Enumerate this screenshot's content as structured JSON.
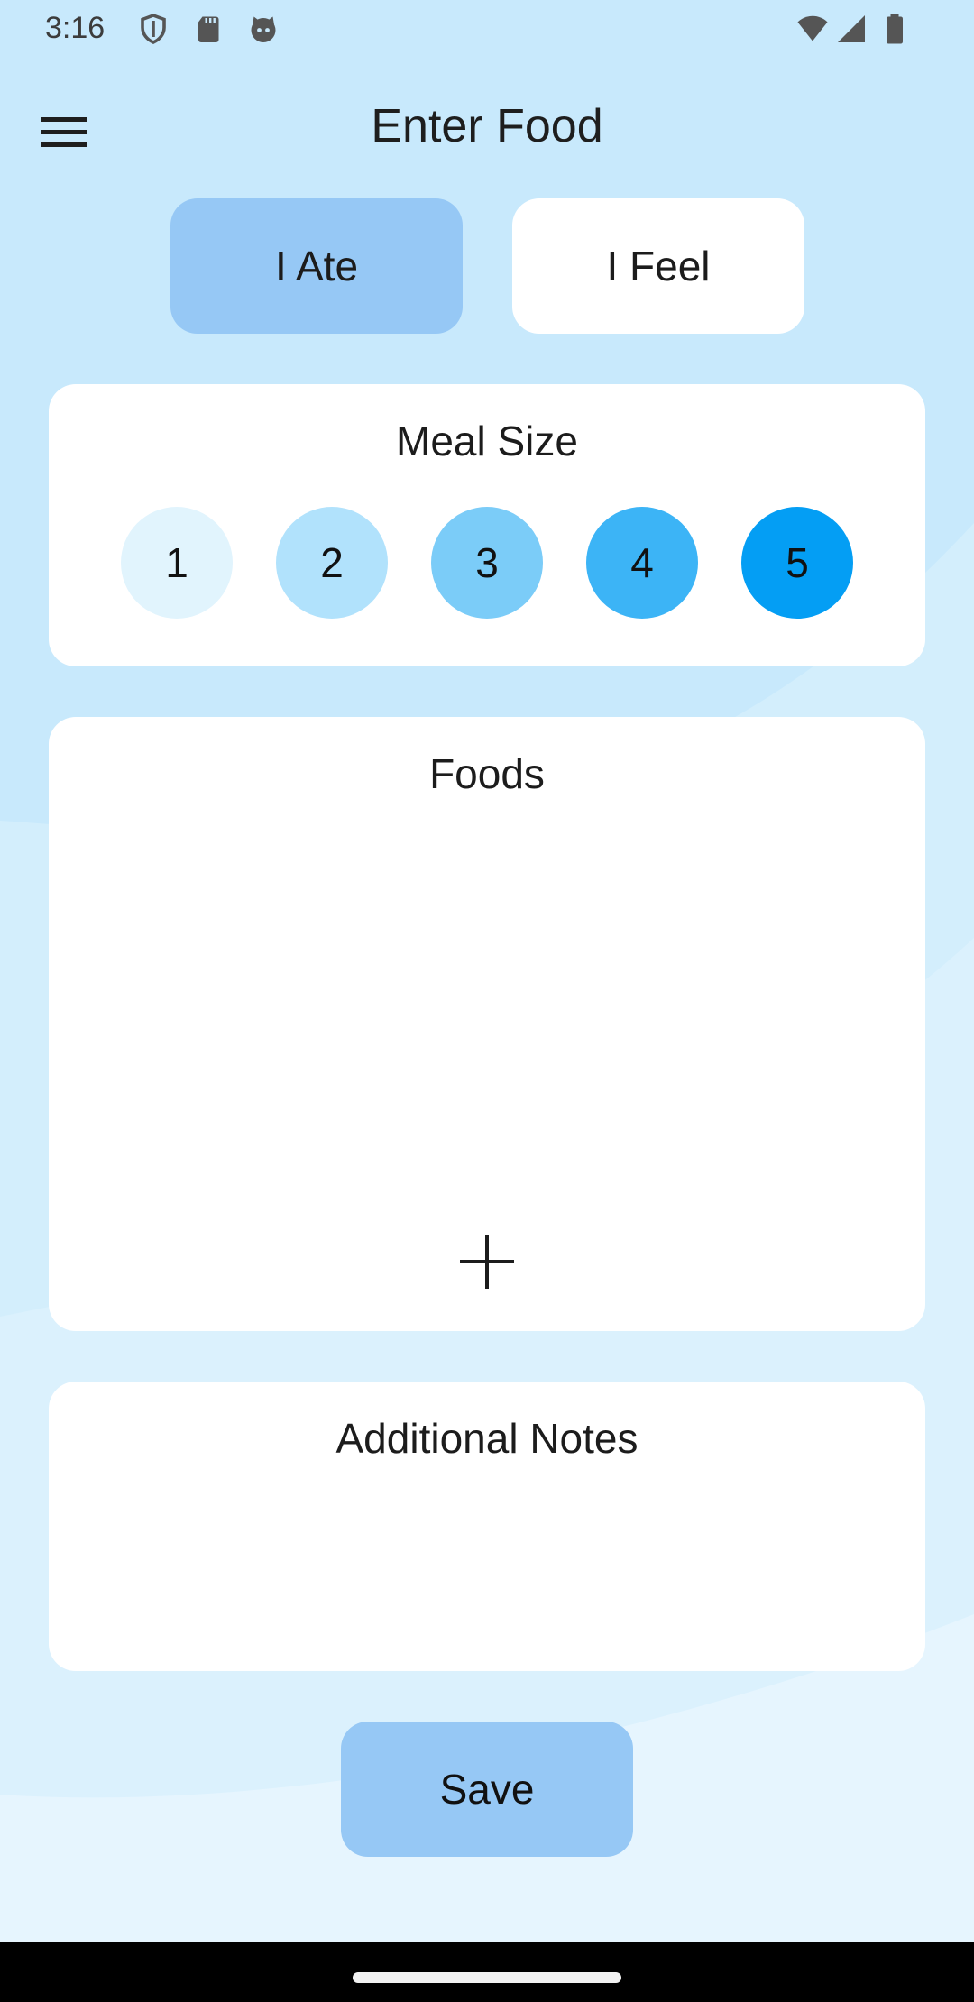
{
  "status_bar": {
    "time": "3:16",
    "left_icons": [
      "shield-icon",
      "sd-card-icon",
      "cat-face-icon"
    ],
    "right_icons": [
      "wifi-icon",
      "cellular-signal-icon",
      "battery-icon"
    ]
  },
  "app_bar": {
    "menu_icon": "hamburger-menu-icon",
    "title": "Enter Food"
  },
  "toggle": {
    "ate_label": "I Ate",
    "feel_label": "I Feel",
    "selected": "I Ate"
  },
  "meal_size": {
    "title": "Meal Size",
    "options": [
      {
        "label": "1",
        "color": "#e1f4fd"
      },
      {
        "label": "2",
        "color": "#b1e2fc"
      },
      {
        "label": "3",
        "color": "#7bccf8"
      },
      {
        "label": "4",
        "color": "#3cb4f6"
      },
      {
        "label": "5",
        "color": "#049ef4"
      }
    ]
  },
  "foods": {
    "title": "Foods",
    "add_icon": "plus-icon"
  },
  "notes": {
    "title": "Additional Notes",
    "value": ""
  },
  "save_label": "Save",
  "colors": {
    "background": "#c8e9fc",
    "accent": "#96c8f5",
    "card": "#ffffff"
  }
}
